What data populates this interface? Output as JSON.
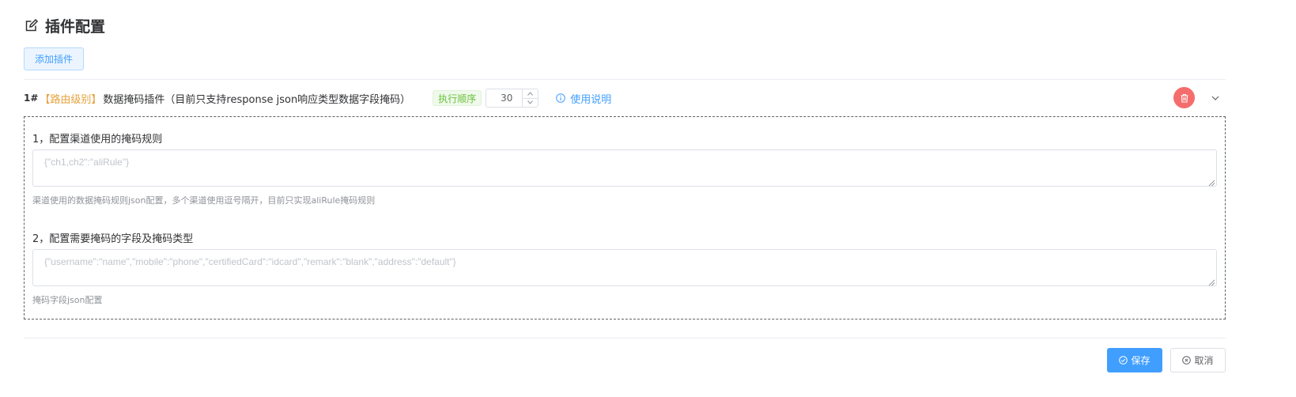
{
  "header": {
    "icon": "edit-icon",
    "title": "插件配置"
  },
  "toolbar": {
    "add_plugin_label": "添加插件"
  },
  "plugin": {
    "index": "1#",
    "level": "【路由级别】",
    "name": "数据掩码插件（目前只支持response json响应类型数据字段掩码）",
    "order_tag": "执行顺序",
    "order_value": "30",
    "usage_link": "使用说明",
    "colors": {
      "level": "#e6a23c",
      "tag": "#67c23a",
      "link": "#409eff",
      "delete": "#f56c6c"
    }
  },
  "config": {
    "fields": [
      {
        "label": "1，配置渠道使用的掩码规则",
        "placeholder": "{\"ch1,ch2\":\"aliRule\"}",
        "hint": "渠道使用的数据掩码规则json配置，多个渠道使用逗号隔开，目前只实现aliRule掩码规则"
      },
      {
        "label": "2，配置需要掩码的字段及掩码类型",
        "placeholder": "{\"username\":\"name\",\"mobile\":\"phone\",\"certifiedCard\":\"idcard\",\"remark\":\"blank\",\"address\":\"default\"}",
        "hint": "掩码字段json配置"
      }
    ]
  },
  "footer": {
    "save_label": "保存",
    "cancel_label": "取消"
  }
}
